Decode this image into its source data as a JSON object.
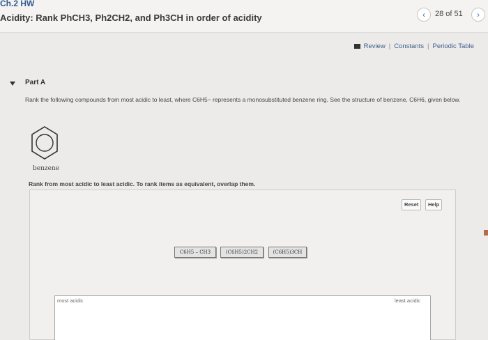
{
  "header": {
    "course": "Ch.2 HW",
    "title": "Acidity: Rank PhCH3, Ph2CH2, and Ph3CH in order of acidity",
    "counter": "28 of 51",
    "prev_icon": "‹",
    "next_icon": "›"
  },
  "resources": {
    "items": [
      "Review",
      "Constants",
      "Periodic Table"
    ],
    "separator": "|"
  },
  "part": {
    "label": "Part A",
    "question": "Rank the following compounds from most acidic to least, where C6H5− represents a monosubstituted benzene ring. See the structure of benzene, C6H6, given below.",
    "structure_label": "benzene",
    "instruction": "Rank from most acidic to least acidic. To rank items as equivalent, overlap them."
  },
  "workspace": {
    "reset_label": "Reset",
    "help_label": "Help",
    "tiles": [
      "C6H5 – CH3",
      "(C6H5)2CH2",
      "(C6H5)3CH"
    ],
    "most_label": "most acidic",
    "least_label": "least acidic"
  },
  "colors": {
    "link": "#3f5f8a",
    "accent": "#2f5a8f",
    "background": "#ecebea"
  }
}
